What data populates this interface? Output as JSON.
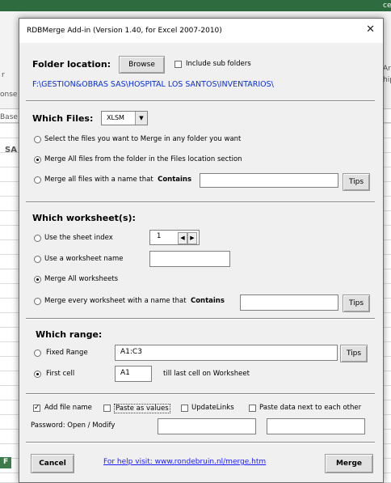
{
  "background": {
    "side_labels": [
      "r",
      "onse",
      "Base",
      "SA",
      "Ar",
      "hip",
      "cer",
      "F"
    ]
  },
  "dialog": {
    "title": "RDBMerge Add-in (Version 1.40, for Excel 2007-2010)",
    "close_label": "✕"
  },
  "folder": {
    "label": "Folder location:",
    "browse_label": "Browse",
    "include_subfolders_label": "Include sub folders",
    "include_subfolders_checked": false,
    "path": "F:\\GESTION&OBRAS SAS\\HOSPITAL LOS SANTOS\\INVENTARIOS\\"
  },
  "files": {
    "label": "Which Files:",
    "type_value": "XLSM",
    "option_select": "Select the files you want to Merge in any folder you want",
    "option_all": "Merge All files from the folder in the Files location section",
    "option_name_prefix": "Merge all files with a name that",
    "option_name_keyword": "Contains",
    "contains_value": "",
    "tips_label": "Tips",
    "selected": "all"
  },
  "worksheets": {
    "label": "Which worksheet(s):",
    "option_index": "Use the sheet index",
    "index_value": "1",
    "option_name": "Use a worksheet name",
    "name_value": "",
    "option_all": "Merge All worksheets",
    "option_contains_prefix": "Merge every worksheet with a name that",
    "option_contains_keyword": "Contains",
    "contains_value": "",
    "tips_label": "Tips",
    "selected": "all"
  },
  "range": {
    "label": "Which range:",
    "option_fixed": "Fixed Range",
    "fixed_value": "A1:C3",
    "tips_label": "Tips",
    "option_first": "First cell",
    "first_value": "A1",
    "first_suffix": "till last cell on Worksheet",
    "selected": "first"
  },
  "options": {
    "add_file_name": "Add file name",
    "add_file_name_checked": true,
    "paste_values": "Paste as values",
    "paste_values_checked": false,
    "update_links": "UpdateLinks",
    "update_links_checked": false,
    "paste_next": "Paste data next to each other",
    "paste_next_checked": false,
    "password_label": "Password: Open / Modify",
    "password_open": "",
    "password_modify": ""
  },
  "footer": {
    "cancel_label": "Cancel",
    "help_text": "For help visit: www.rondebruin.nl/merge.htm",
    "merge_label": "Merge"
  },
  "icons": {
    "close": "close-icon",
    "dropdown": "chevron-down-icon",
    "spin_left": "arrow-left-icon",
    "spin_right": "arrow-right-icon"
  }
}
